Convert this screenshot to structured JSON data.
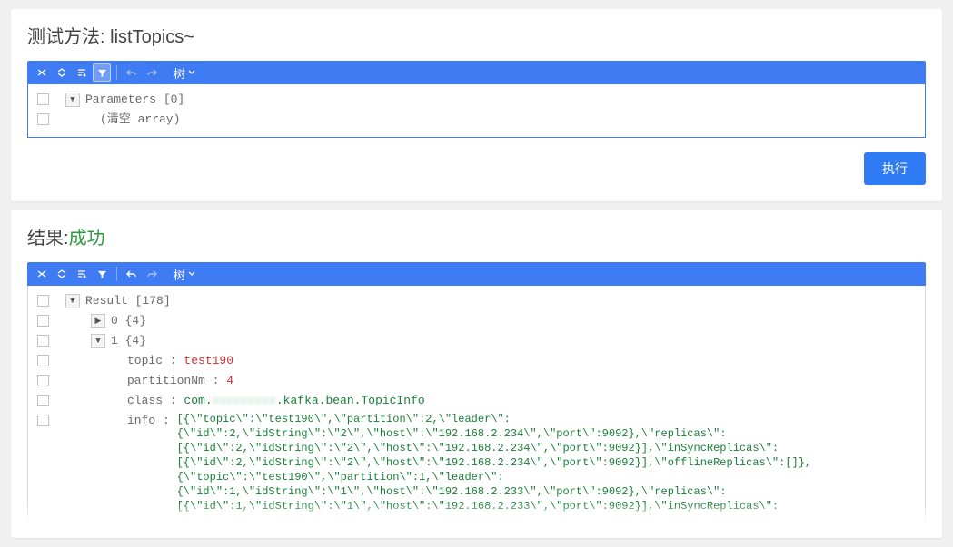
{
  "top": {
    "title_prefix": "测试方法: ",
    "title_method": "listTopics~",
    "toolbar": {
      "view_label": "树"
    },
    "rows": {
      "parameters_label": "Parameters [0]",
      "empty_label": "(清空 array)"
    },
    "execute_btn": "执行"
  },
  "result": {
    "title_prefix": "结果:",
    "title_status": "成功",
    "toolbar": {
      "view_label": "树"
    },
    "root_label": "Result [178]",
    "idx0": "0 {4}",
    "idx1": "1 {4}",
    "fields": {
      "topic_key": "topic : ",
      "topic_val": "test190",
      "partition_key": "partitionNm : ",
      "partition_val": "4",
      "class_key": "class : ",
      "class_prefix": "com.",
      "class_suffix": ".kafka.bean.TopicInfo",
      "info_key": "info : "
    },
    "info_lines": [
      "[{\\\"topic\\\":\\\"test190\\\",\\\"partition\\\":2,\\\"leader\\\":",
      "{\\\"id\\\":2,\\\"idString\\\":\\\"2\\\",\\\"host\\\":\\\"192.168.2.234\\\",\\\"port\\\":9092},\\\"replicas\\\":",
      "[{\\\"id\\\":2,\\\"idString\\\":\\\"2\\\",\\\"host\\\":\\\"192.168.2.234\\\",\\\"port\\\":9092}],\\\"inSyncReplicas\\\":",
      "[{\\\"id\\\":2,\\\"idString\\\":\\\"2\\\",\\\"host\\\":\\\"192.168.2.234\\\",\\\"port\\\":9092}],\\\"offlineReplicas\\\":[]},",
      "{\\\"topic\\\":\\\"test190\\\",\\\"partition\\\":1,\\\"leader\\\":",
      "{\\\"id\\\":1,\\\"idString\\\":\\\"1\\\",\\\"host\\\":\\\"192.168.2.233\\\",\\\"port\\\":9092},\\\"replicas\\\":",
      "[{\\\"id\\\":1,\\\"idString\\\":\\\"1\\\",\\\"host\\\":\\\"192.168.2.233\\\",\\\"port\\\":9092}],\\\"inSyncReplicas\\\":"
    ]
  }
}
